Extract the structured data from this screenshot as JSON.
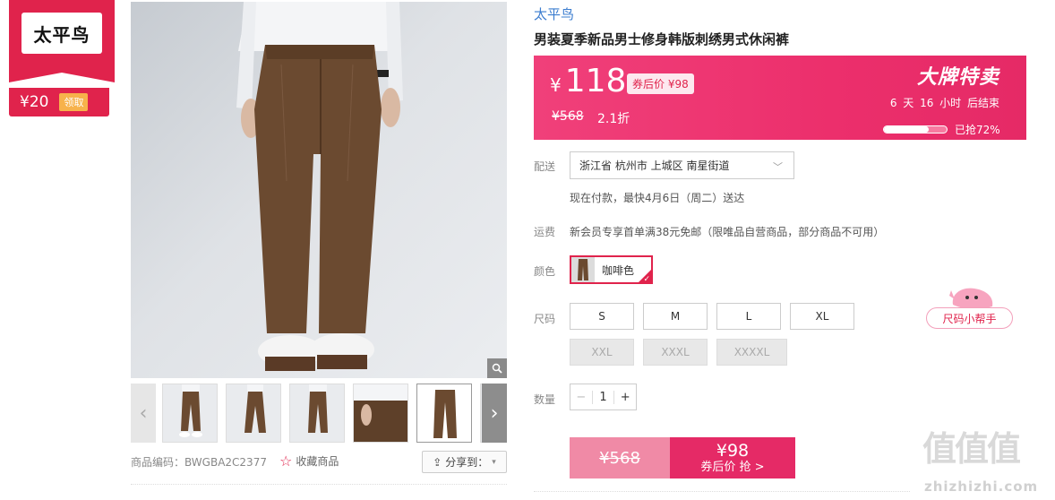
{
  "brand_badge": {
    "name": "太平鸟",
    "coupon_amount": "¥20",
    "coupon_button": "领取"
  },
  "product": {
    "brand": "太平鸟",
    "title": "男装夏季新品男士修身韩版刺绣男式休闲裤",
    "code_label": "商品编码：BWGBA2C2377",
    "favorite_label": "收藏商品",
    "share_label": "分享到："
  },
  "price": {
    "currency": "¥",
    "current": "118",
    "after_coupon": "券后价 ¥98",
    "original": "¥568",
    "discount": "2.1折",
    "sale_title": "大牌特卖",
    "countdown": "6 天 16 小时 后结束",
    "sold_progress": 0.72,
    "sold_text": "已抢72%"
  },
  "shipping": {
    "label": "配送",
    "address": "浙江省 杭州市 上城区 南星街道",
    "delivery_note": "现在付款，最快4月6日（周二）送达"
  },
  "freight": {
    "label": "运费",
    "text": "新会员专享首单满38元免邮（限唯品自营商品，部分商品不可用）"
  },
  "color": {
    "label": "颜色",
    "selected": "咖啡色"
  },
  "size": {
    "label": "尺码",
    "options": [
      {
        "label": "S",
        "available": true
      },
      {
        "label": "M",
        "available": true
      },
      {
        "label": "L",
        "available": true
      },
      {
        "label": "XL",
        "available": true
      },
      {
        "label": "XXL",
        "available": false
      },
      {
        "label": "XXXL",
        "available": false
      },
      {
        "label": "XXXXL",
        "available": false
      }
    ],
    "helper": "尺码小帮手"
  },
  "quantity": {
    "label": "数量",
    "value": "1",
    "minus": "−",
    "plus": "+"
  },
  "buy": {
    "original": "¥568",
    "coupon_price": "¥98",
    "coupon_action": "券后价 抢 >"
  },
  "watermark": {
    "logo": "值值值",
    "url": "zhizhizhi.com"
  },
  "colors": {
    "accent": "#e0234c",
    "price_bar": "#ec2f6c",
    "link": "#3b7ccf"
  }
}
